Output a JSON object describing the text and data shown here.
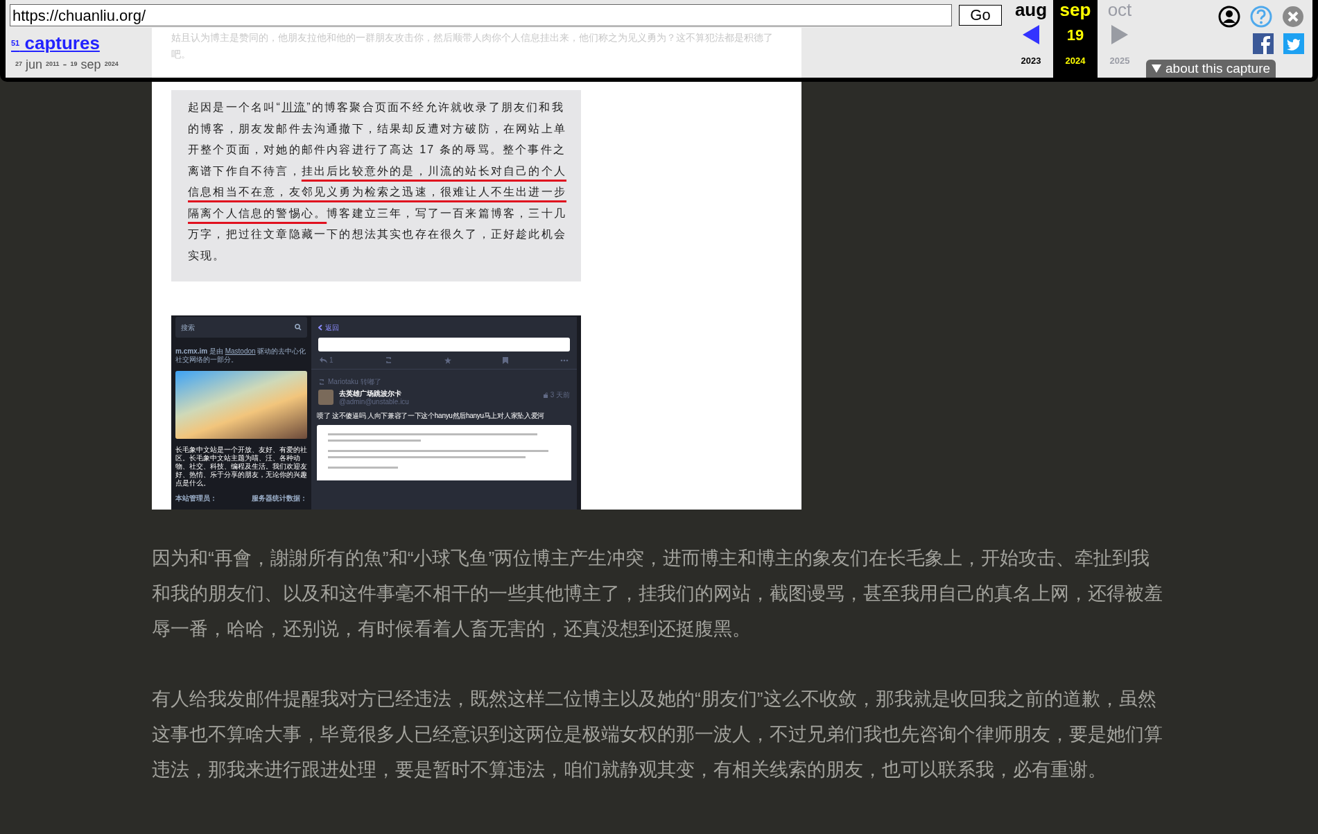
{
  "toolbar": {
    "url": "https://chuanliu.org/",
    "go_button": "Go",
    "captures_count": "51",
    "captures_label": "captures",
    "range": [
      {
        "day": "27",
        "month": "jun",
        "year": "2011"
      },
      {
        "day": "19",
        "month": "sep",
        "year": "2024"
      }
    ],
    "range_separator": "-",
    "months": [
      {
        "label": "aug",
        "year": "2023",
        "selected": false,
        "disabled": false
      },
      {
        "label": "sep",
        "day": "19",
        "year": "2024",
        "selected": true,
        "disabled": false
      },
      {
        "label": "oct",
        "year": "2025",
        "selected": false,
        "disabled": true
      }
    ],
    "about_button": "about this capture"
  },
  "faded_text": "姑且认为博主是赞同的，他朋友拉他和他的一群朋友攻击你，然后顺带人肉你个人信息挂出来，他们称之为见义勇为？这不算犯法都是积德了吧。",
  "quote": [
    {
      "kind": "plain",
      "text": "起因是一个名叫“"
    },
    {
      "kind": "link",
      "text": "川流"
    },
    {
      "kind": "plain",
      "text": "”的博客聚合页面不经允许就收录了朋友们和我的博客，朋友发邮件去沟通撤下，结果却反遭对方破防，在网站上单开整个页面，对她的邮件内容进行了高达 17 条的辱骂。整个事件之离谱下作自不待言，"
    },
    {
      "kind": "highlight",
      "text": "挂出后比较意外的是，川流的站长对自己的个人信息相当不在意，友邻见义勇为检索之迅速，很难让人不生出进一步隔离个人信息的警惕心。"
    },
    {
      "kind": "plain",
      "text": "博客建立三年，写了一百来篇博客，三十几万字，把过往文章隐藏一下的想法其实也存在很久了，正好趁此机会实现。"
    }
  ],
  "embedded_screenshot": {
    "search_placeholder": "搜索",
    "about": [
      {
        "kind": "bold",
        "text": "m.cmx.im"
      },
      {
        "kind": "plain",
        "text": " 是由 "
      },
      {
        "kind": "link",
        "text": "Mastodon"
      },
      {
        "kind": "plain",
        "text": " 驱动的去中心化社交网络的一部分。"
      }
    ],
    "description": "长毛象中文站是一个开放、友好、有爱的社区。长毛象中文站主题为喵、汪、各种动物、社交、科技、编程及生活。我们欢迎友好、热情、乐于分享的朋友，无论你的兴趣点是什么。",
    "admin_label": "本站管理员：",
    "stats_label": "服务器统计数据：",
    "back_link": "返回",
    "reply_count": "1",
    "boosted_by": "Mariotaku 转嘟了",
    "display_name": "去英雄广场跳波尔卡",
    "handle": "@admin@unstable.icu",
    "time": "3 天前",
    "post_text": "喷了 这不傻逼吗 人向下兼容了一下这个hanyu然后hanyu马上对人家坠入爱河"
  },
  "paragraphs": [
    "因为和“再會，謝謝所有的魚”和“小球飞鱼”两位博主产生冲突，进而博主和博主的象友们在长毛象上，开始攻击、牵扯到我和我的朋友们、以及和这件事毫不相干的一些其他博主了，挂我们的网站，截图谩骂，甚至我用自己的真名上网，还得被羞辱一番，哈哈，还别说，有时候看着人畜无害的，还真没想到还挺腹黑。",
    "有人给我发邮件提醒我对方已经违法，既然这样二位博主以及她的“朋友们”这么不收敛，那我就是收回我之前的道歉，虽然这事也不算啥大事，毕竟很多人已经意识到这两位是极端女权的那一波人，不过兄弟们我也先咨询个律师朋友，要是她们算违法，那我来进行跟进处理，要是暂时不算违法，咱们就静观其变，有相关线索的朋友，也可以联系我，必有重谢。"
  ]
}
